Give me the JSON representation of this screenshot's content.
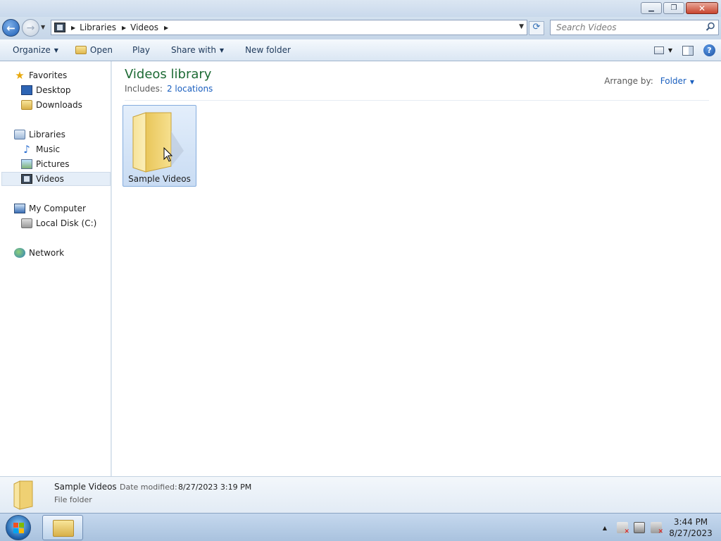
{
  "window": {
    "minimize_glyph": "▁",
    "maximize_glyph": "❐",
    "close_glyph": "✕"
  },
  "address": {
    "crumbs": [
      "Libraries",
      "Videos"
    ],
    "search_placeholder": "Search Videos",
    "icons": {
      "back": "back-arrow-icon",
      "forward": "forward-arrow-icon",
      "refresh": "refresh-icon",
      "search": "magnifier-icon"
    }
  },
  "toolbar": {
    "organize": "Organize",
    "open": "Open",
    "play": "Play",
    "share_with": "Share with",
    "new_folder": "New folder",
    "help": "?"
  },
  "nav": {
    "favorites": "Favorites",
    "desktop": "Desktop",
    "downloads": "Downloads",
    "libraries": "Libraries",
    "music": "Music",
    "pictures": "Pictures",
    "videos": "Videos",
    "my_computer": "My Computer",
    "local_disk": "Local Disk (C:)",
    "network": "Network"
  },
  "content": {
    "title": "Videos library",
    "includes_label": "Includes:",
    "includes_link": "2 locations",
    "arrange_label": "Arrange by:",
    "arrange_value": "Folder",
    "items": [
      {
        "name": "Sample Videos",
        "type": "folder",
        "selected": true
      }
    ]
  },
  "details": {
    "name": "Sample Videos",
    "date_label": "Date modified:",
    "date_value": "8/27/2023 3:19 PM",
    "type": "File folder"
  },
  "taskbar": {
    "time": "3:44 PM",
    "date": "8/27/2023"
  },
  "colors": {
    "library_title": "#1e6b35",
    "link": "#1a5fbf",
    "selection": "#c9dcf3"
  }
}
